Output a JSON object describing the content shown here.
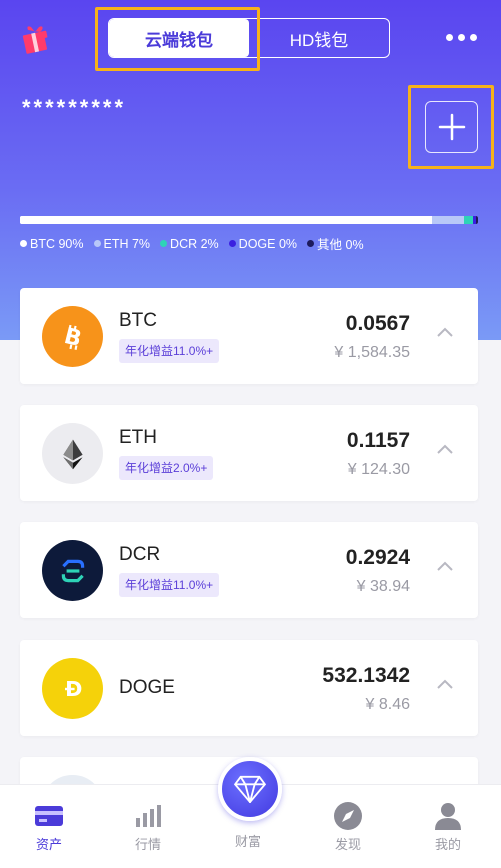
{
  "header": {
    "tabs": [
      {
        "label": "云端钱包",
        "active": true
      },
      {
        "label": "HD钱包",
        "active": false
      }
    ]
  },
  "wallet": {
    "balance_masked": "*********"
  },
  "distribution": [
    {
      "label": "BTC 90%",
      "percent": 90,
      "color": "#ffffff"
    },
    {
      "label": "ETH 7%",
      "percent": 7,
      "color": "#b8c8f8"
    },
    {
      "label": "DCR 2%",
      "percent": 2,
      "color": "#2ed3b7"
    },
    {
      "label": "DOGE 0%",
      "percent": 0.5,
      "color": "#3b1fe0"
    },
    {
      "label": "其他 0%",
      "percent": 0.5,
      "color": "#1d1a5c"
    }
  ],
  "assets": [
    {
      "name": "BTC",
      "badge": "年化增益11.0%+",
      "amount": "0.0567",
      "fiat": "¥ 1,584.35"
    },
    {
      "name": "ETH",
      "badge": "年化增益2.0%+",
      "amount": "0.1157",
      "fiat": "¥ 124.30"
    },
    {
      "name": "DCR",
      "badge": "年化增益11.0%+",
      "amount": "0.2924",
      "fiat": "¥ 38.94"
    },
    {
      "name": "DOGE",
      "badge": "",
      "amount": "532.1342",
      "fiat": "¥ 8.46"
    }
  ],
  "tabbar": {
    "items": [
      {
        "label": "资产",
        "active": true
      },
      {
        "label": "行情",
        "active": false
      },
      {
        "label": "财富",
        "active": false
      },
      {
        "label": "发现",
        "active": false
      },
      {
        "label": "我的",
        "active": false
      }
    ]
  },
  "colors": {
    "accent": "#4b3bd9",
    "highlight_box": "#f6b21a",
    "btc": "#f7931a",
    "doge": "#f5d20a",
    "dcr_bg": "#0d1a3a"
  }
}
